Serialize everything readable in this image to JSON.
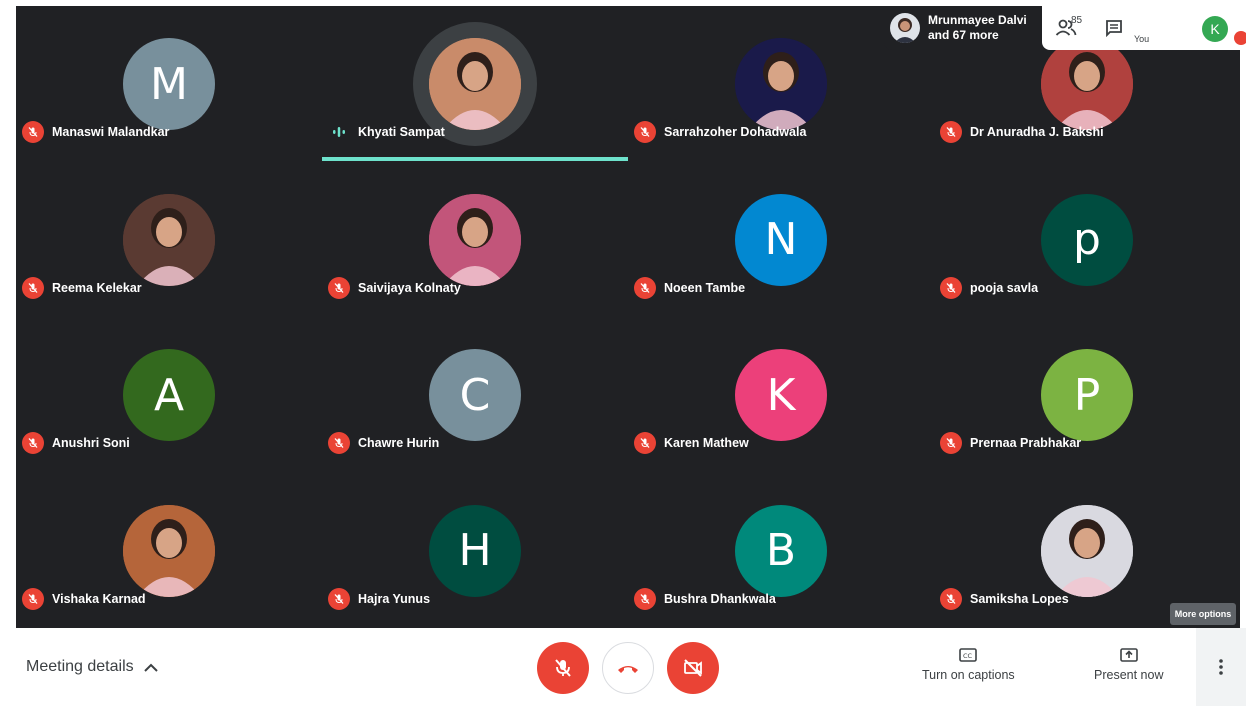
{
  "top_bar": {
    "presenter_name": "Mrunmayee Dalvi",
    "presenter_more": "and 67 more",
    "people_count": "85",
    "you_label": "You",
    "you_initial": "K"
  },
  "participants": [
    {
      "name": "Manaswi Malandkar",
      "initial": "M",
      "color": "#78909c",
      "photo": false
    },
    {
      "name": "Khyati Sampat",
      "initial": "",
      "color": "#c98b6a",
      "photo": true,
      "speaking": true
    },
    {
      "name": "Sarrahzoher Dohadwala",
      "initial": "",
      "color": "#1a1a4a",
      "photo": true
    },
    {
      "name": "Dr Anuradha J. Bakshi",
      "initial": "",
      "color": "#b0413e",
      "photo": true
    },
    {
      "name": "Reema Kelekar",
      "initial": "",
      "color": "#5a3a32",
      "photo": true
    },
    {
      "name": "Saivijaya Kolnaty",
      "initial": "",
      "color": "#c2557a",
      "photo": true
    },
    {
      "name": "Noeen Tambe",
      "initial": "N",
      "color": "#0288d1",
      "photo": false
    },
    {
      "name": "pooja savla",
      "initial": "p",
      "color": "#004d40",
      "photo": false
    },
    {
      "name": "Anushri Soni",
      "initial": "A",
      "color": "#33691e",
      "photo": false
    },
    {
      "name": "Chawre Hurin",
      "initial": "C",
      "color": "#78909c",
      "photo": false
    },
    {
      "name": "Karen Mathew",
      "initial": "K",
      "color": "#ec407a",
      "photo": false
    },
    {
      "name": "Prernaa Prabhakar",
      "initial": "P",
      "color": "#7cb342",
      "photo": false
    },
    {
      "name": "Vishaka Karnad",
      "initial": "",
      "color": "#b5653a",
      "photo": true
    },
    {
      "name": "Hajra Yunus",
      "initial": "H",
      "color": "#004d40",
      "photo": false
    },
    {
      "name": "Bushra Dhankwala",
      "initial": "B",
      "color": "#00897b",
      "photo": false
    },
    {
      "name": "Samiksha Lopes",
      "initial": "",
      "color": "#d9d9e0",
      "photo": true
    }
  ],
  "tooltip": "More options",
  "bottom_bar": {
    "meeting_details": "Meeting details",
    "captions_label": "Turn on captions",
    "present_label": "Present now"
  },
  "colors": {
    "mic_off": "#ea4335",
    "speaking": "#6ee2cc",
    "background": "#202124"
  }
}
